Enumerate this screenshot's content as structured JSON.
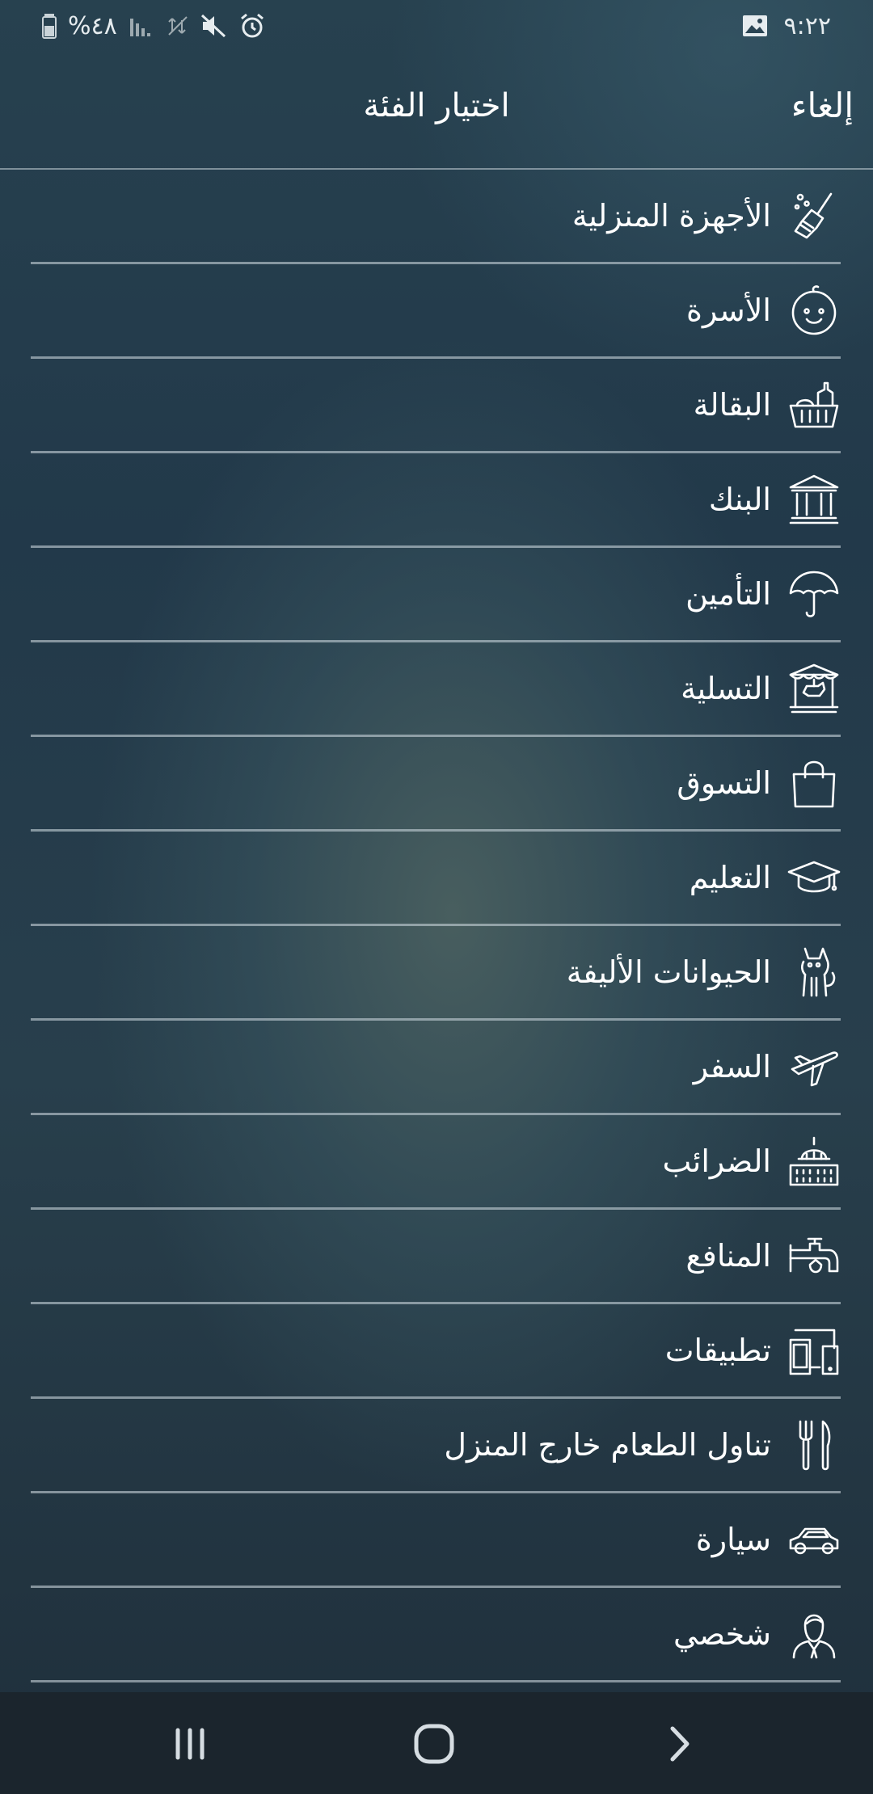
{
  "status_bar": {
    "time": "٩:٢٢",
    "battery": "%٤٨",
    "icons": [
      "gallery-icon",
      "alarm-icon",
      "mute-icon",
      "data-off-icon",
      "signal-icon",
      "battery-icon"
    ]
  },
  "header": {
    "title": "اختيار الفئة",
    "cancel_label": "إلغاء"
  },
  "categories": [
    {
      "label": "الأجهزة المنزلية",
      "icon": "broom-icon"
    },
    {
      "label": "الأسرة",
      "icon": "baby-face-icon"
    },
    {
      "label": "البقالة",
      "icon": "grocery-basket-icon"
    },
    {
      "label": "البنك",
      "icon": "bank-icon"
    },
    {
      "label": "التأمين",
      "icon": "umbrella-icon"
    },
    {
      "label": "التسلية",
      "icon": "carousel-icon"
    },
    {
      "label": "التسوق",
      "icon": "shopping-bag-icon"
    },
    {
      "label": "التعليم",
      "icon": "graduation-cap-icon"
    },
    {
      "label": "الحيوانات الأليفة",
      "icon": "cat-icon"
    },
    {
      "label": "السفر",
      "icon": "airplane-icon"
    },
    {
      "label": "الضرائب",
      "icon": "capitol-building-icon"
    },
    {
      "label": "المنافع",
      "icon": "water-tap-icon"
    },
    {
      "label": "تطبيقات",
      "icon": "devices-icon"
    },
    {
      "label": "تناول الطعام خارج المنزل",
      "icon": "fork-knife-icon"
    },
    {
      "label": "سيارة",
      "icon": "car-icon"
    },
    {
      "label": "شخصي",
      "icon": "person-icon"
    }
  ],
  "nav": {
    "icons": [
      "recent-apps-icon",
      "home-icon",
      "back-icon"
    ]
  }
}
